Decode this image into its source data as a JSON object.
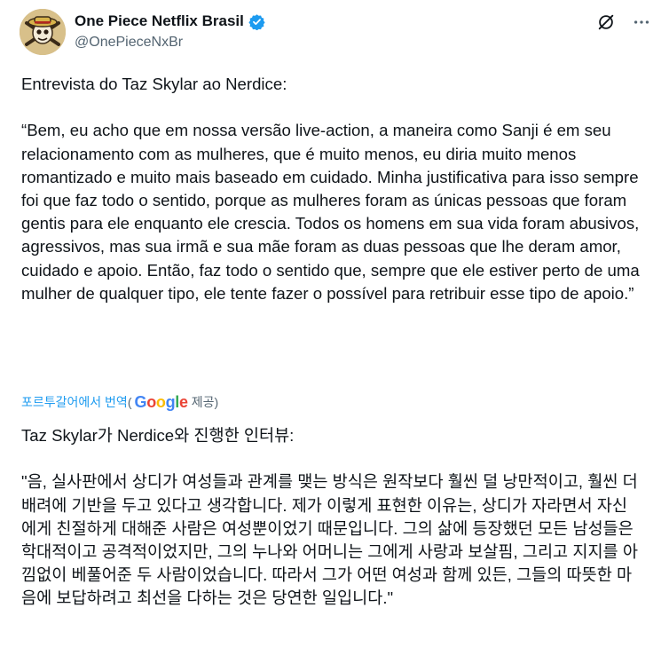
{
  "account": {
    "display_name": "One Piece Netflix Brasil",
    "handle": "@OnePieceNxBr"
  },
  "icons": {
    "avatar": "jolly-roger-avatar",
    "verified": "verified-badge-icon",
    "grok": "grok-icon",
    "more": "more-icon"
  },
  "colors": {
    "accent": "#1d9bf0",
    "secondary_text": "#536471"
  },
  "tweet": {
    "original_text": "Entrevista do Taz Skylar ao Nerdice:\n\n“Bem, eu acho que em nossa versão live-action, a maneira como Sanji é em seu relacionamento com as mulheres, que é muito menos, eu diria muito menos romantizado e muito mais baseado em cuidado. Minha justificativa para isso sempre foi que faz todo o sentido, porque as mulheres foram as únicas pessoas que foram gentis para ele enquanto ele crescia. Todos os homens em sua vida foram abusivos, agressivos, mas sua irmã e sua mãe foram as duas pessoas que lhe deram amor, cuidado e apoio. Então, faz todo o sentido que, sempre que ele estiver perto de uma mulher de qualquer tipo, ele tente fazer o possível para retribuir esse tipo de apoio.”",
    "translated_text": "Taz Skylar가 Nerdice와 진행한 인터뷰:\n\n\"음, 실사판에서 상디가 여성들과 관계를 맺는 방식은 원작보다 훨씬 덜 낭만적이고, 훨씬 더 배려에 기반을 두고 있다고 생각합니다. 제가 이렇게 표현한 이유는, 상디가 자라면서 자신에게 친절하게 대해준 사람은 여성뿐이었기 때문입니다. 그의 삶에 등장했던 모든 남성들은 학대적이고 공격적이었지만, 그의 누나와 어머니는 그에게 사랑과 보살핌, 그리고 지지를 아낌없이 베풀어준 두 사람이었습니다. 따라서 그가 어떤 여성과 함께 있든, 그들의 따뜻한 마음에 보답하려고 최선을 다하는 것은 당연한 일입니다.\""
  },
  "translation": {
    "link_label": "포르투갈어에서 번역",
    "open_paren": "(",
    "provider": "Google",
    "provided_label": "제공)"
  }
}
